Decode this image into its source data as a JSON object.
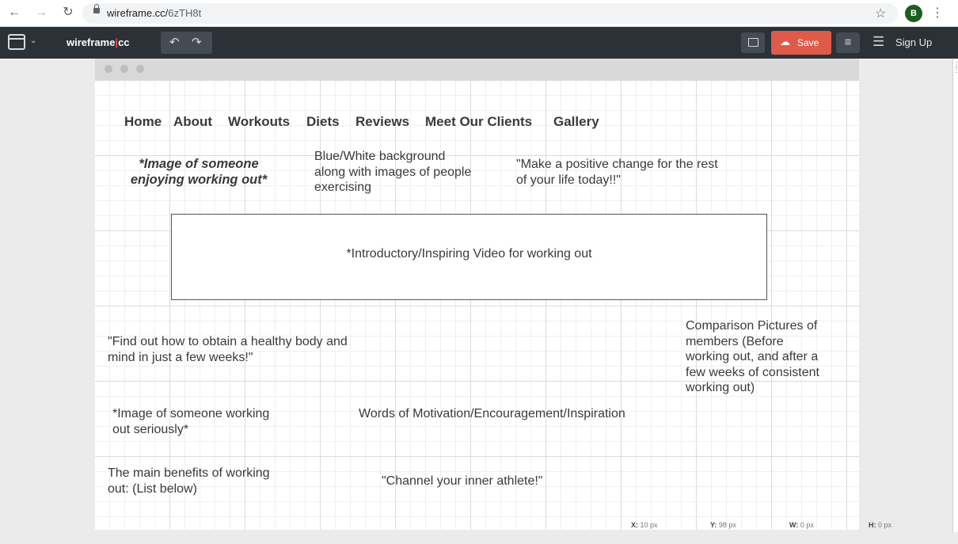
{
  "browser": {
    "url_host": "wireframe.cc/",
    "url_path": "6zTH8t",
    "avatar_letter": "B",
    "icons": [
      "back-arrow-icon",
      "forward-arrow-icon",
      "reload-icon",
      "lock-icon",
      "star-icon",
      "kebab-menu-icon"
    ]
  },
  "app": {
    "brand_left": "wireframe",
    "brand_pipe": "|",
    "brand_right": "cc",
    "save_label": "Save",
    "signup_label": "Sign Up",
    "accent_color": "#e05a4a",
    "toolbar_color": "#2c3138"
  },
  "wireframe": {
    "nav": [
      "Home",
      "About",
      "Workouts",
      "Diets",
      "Reviews",
      "Meet Our Clients",
      "Gallery"
    ],
    "image_enjoying": [
      "*Image of someone",
      "enjoying working out*"
    ],
    "background_note": [
      "Blue/White background",
      "along with images of people",
      "exercising"
    ],
    "quote_change": [
      "\"Make a positive change for the rest",
      "of your life today!!\""
    ],
    "video_label": "*Introductory/Inspiring Video for working out",
    "find_out": [
      "\"Find out how to obtain a healthy body and",
      "mind in just a few weeks!\""
    ],
    "comparison": [
      "Comparison Pictures of",
      "members (Before",
      "working out, and after a",
      "few weeks of consistent",
      "working out)"
    ],
    "image_serious": [
      "*Image of someone working",
      "out seriously*"
    ],
    "motivation": "Words of Motivation/Encouragement/Inspiration",
    "benefits": [
      "The main benefits of working",
      "out: (List below)"
    ],
    "athlete_quote": "\"Channel your inner athlete!\""
  },
  "status": {
    "x_label": "X:",
    "x_value": "10 px",
    "y_label": "Y:",
    "y_value": "98 px",
    "w_label": "W:",
    "w_value": "0 px",
    "h_label": "H:",
    "h_value": "0 px"
  }
}
